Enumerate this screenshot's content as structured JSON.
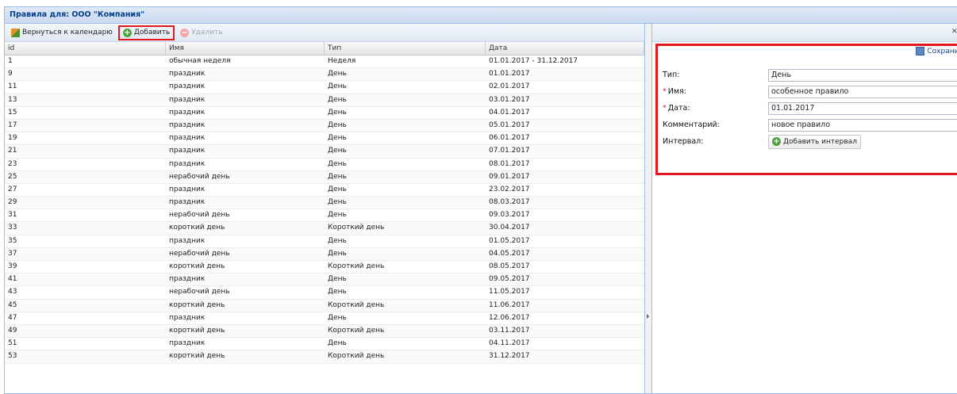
{
  "title": "Правила для: ООО \"Компания\"",
  "toolbar": {
    "back_label": "Вернуться к календарю",
    "add_label": "Добавить",
    "delete_label": "Удалить"
  },
  "grid": {
    "columns": [
      "id",
      "Имя",
      "Тип",
      "Дата"
    ],
    "rows": [
      [
        "1",
        "обычная неделя",
        "Неделя",
        "01.01.2017 - 31.12.2017"
      ],
      [
        "9",
        "праздник",
        "День",
        "01.01.2017"
      ],
      [
        "11",
        "праздник",
        "День",
        "02.01.2017"
      ],
      [
        "13",
        "праздник",
        "День",
        "03.01.2017"
      ],
      [
        "15",
        "праздник",
        "День",
        "04.01.2017"
      ],
      [
        "17",
        "праздник",
        "День",
        "05.01.2017"
      ],
      [
        "19",
        "праздник",
        "День",
        "06.01.2017"
      ],
      [
        "21",
        "праздник",
        "День",
        "07.01.2017"
      ],
      [
        "23",
        "праздник",
        "День",
        "08.01.2017"
      ],
      [
        "25",
        "нерабочий день",
        "День",
        "09.01.2017"
      ],
      [
        "27",
        "праздник",
        "День",
        "23.02.2017"
      ],
      [
        "29",
        "праздник",
        "День",
        "08.03.2017"
      ],
      [
        "31",
        "нерабочий день",
        "День",
        "09.03.2017"
      ],
      [
        "33",
        "короткий день",
        "Короткий день",
        "30.04.2017"
      ],
      [
        "35",
        "праздник",
        "День",
        "01.05.2017"
      ],
      [
        "37",
        "нерабочий день",
        "День",
        "04.05.2017"
      ],
      [
        "39",
        "короткий день",
        "Короткий день",
        "08.05.2017"
      ],
      [
        "41",
        "праздник",
        "День",
        "09.05.2017"
      ],
      [
        "43",
        "нерабочий день",
        "День",
        "11.05.2017"
      ],
      [
        "45",
        "короткий день",
        "Короткий день",
        "11.06.2017"
      ],
      [
        "47",
        "праздник",
        "День",
        "12.06.2017"
      ],
      [
        "49",
        "короткий день",
        "Короткий день",
        "03.11.2017"
      ],
      [
        "51",
        "праздник",
        "День",
        "04.11.2017"
      ],
      [
        "53",
        "короткий день",
        "Короткий день",
        "31.12.2017"
      ]
    ]
  },
  "form": {
    "save_label": "Сохранить",
    "type_label": "Тип:",
    "type_value": "День",
    "name_label": "Имя:",
    "name_value": "особенное правило",
    "date_label": "Дата:",
    "date_value": "01.01.2017",
    "comment_label": "Комментарий:",
    "comment_value": "новое правило",
    "interval_label": "Интервал:",
    "add_interval_label": "Добавить интервал",
    "required_mark": "*"
  },
  "colors": {
    "highlight": "#e0191e",
    "header_text": "#04408c",
    "add_icon": "#4da339"
  }
}
